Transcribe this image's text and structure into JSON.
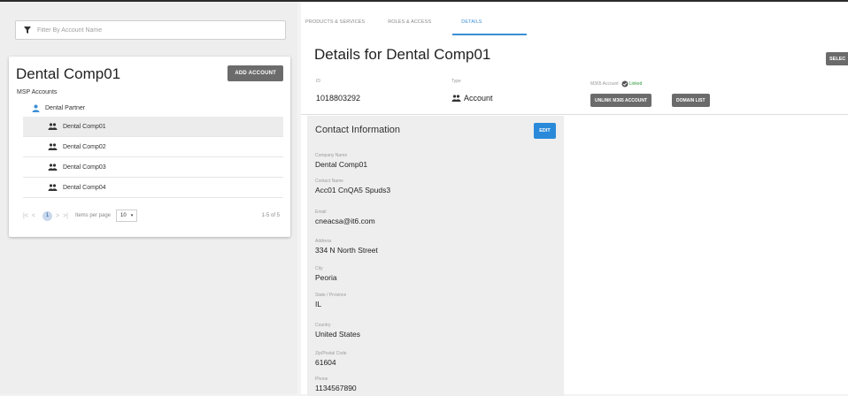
{
  "filter": {
    "placeholder": "Filter By Account Name"
  },
  "account_card": {
    "title": "Dental Comp01",
    "add_button": "ADD ACCOUNT",
    "section_label": "MSP Accounts",
    "parent": {
      "label": "Dental Partner",
      "icon": "person-icon"
    },
    "items": [
      {
        "label": "Dental Comp01",
        "selected": true
      },
      {
        "label": "Dental Comp02",
        "selected": false
      },
      {
        "label": "Dental Comp03",
        "selected": false
      },
      {
        "label": "Dental Comp04",
        "selected": false
      }
    ],
    "pager": {
      "first": "|<",
      "prev": "<",
      "page": "1",
      "next": ">",
      "last": ">|",
      "per_page_label": "Items per page",
      "per_page_value": "10",
      "range": "1-5 of 5"
    }
  },
  "tabs": [
    {
      "label": "PRODUCTS & SERVICES",
      "active": false
    },
    {
      "label": "ROLES & ACCESS",
      "active": false
    },
    {
      "label": "DETAILS",
      "active": true
    }
  ],
  "details": {
    "title": "Details for Dental Comp01",
    "select_button": "SELEC",
    "id_label": "ID",
    "id_value": "1018803292",
    "type_label": "Type",
    "type_value": "Account",
    "m365_label": "M365 Account",
    "m365_status": "Linked",
    "unlink_button": "UNLINK M365 ACCOUNT",
    "domain_button": "DOMAIN LIST"
  },
  "contact": {
    "title": "Contact Information",
    "edit_button": "EDIT",
    "fields": [
      {
        "label": "Company Name",
        "value": "Dental Comp01"
      },
      {
        "label": "Contact Name",
        "value": "Acc01 CnQA5 Spuds3"
      },
      {
        "label": "Email",
        "value": "cneacsa@it6.com"
      },
      {
        "label": "Address",
        "value": "334 N North Street"
      },
      {
        "label": "City",
        "value": "Peoria"
      },
      {
        "label": "State / Province",
        "value": "IL"
      },
      {
        "label": "Country",
        "value": "United States"
      },
      {
        "label": "Zip/Postal Code",
        "value": "61604"
      },
      {
        "label": "Phone",
        "value": "1134567890"
      }
    ]
  },
  "colors": {
    "accent": "#3b8fd6",
    "primary_button": "#2a8ad9",
    "gray_button": "#6b6b6b",
    "linked": "#2e9a3a"
  }
}
